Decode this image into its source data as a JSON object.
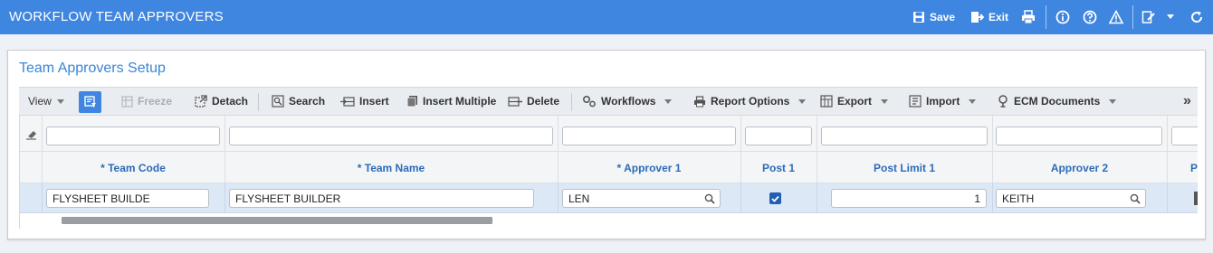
{
  "window": {
    "title": "WORKFLOW TEAM APPROVERS",
    "save_label": "Save",
    "exit_label": "Exit"
  },
  "panel": {
    "title": "Team Approvers Setup"
  },
  "toolbar": {
    "view": "View",
    "freeze": "Freeze",
    "detach": "Detach",
    "search": "Search",
    "insert": "Insert",
    "insert_multiple": "Insert Multiple",
    "delete": "Delete",
    "workflows": "Workflows",
    "report_options": "Report Options",
    "export": "Export",
    "import": "Import",
    "ecm_documents": "ECM Documents",
    "more": "»"
  },
  "grid": {
    "headers": {
      "team_code": "* Team Code",
      "team_name": "* Team Name",
      "approver1": "* Approver 1",
      "post1": "Post 1",
      "post_limit1": "Post Limit 1",
      "approver2": "Approver 2",
      "partial": "P"
    },
    "row": {
      "team_code": "FLYSHEET BUILDE",
      "team_name": "FLYSHEET BUILDER",
      "approver1": "LEN",
      "post1_checked": true,
      "post_limit1": "1",
      "approver2": "KEITH"
    }
  },
  "colors": {
    "accent": "#3f86e0",
    "header_text": "#2d6bb8",
    "selected_row": "#dde8f7"
  }
}
